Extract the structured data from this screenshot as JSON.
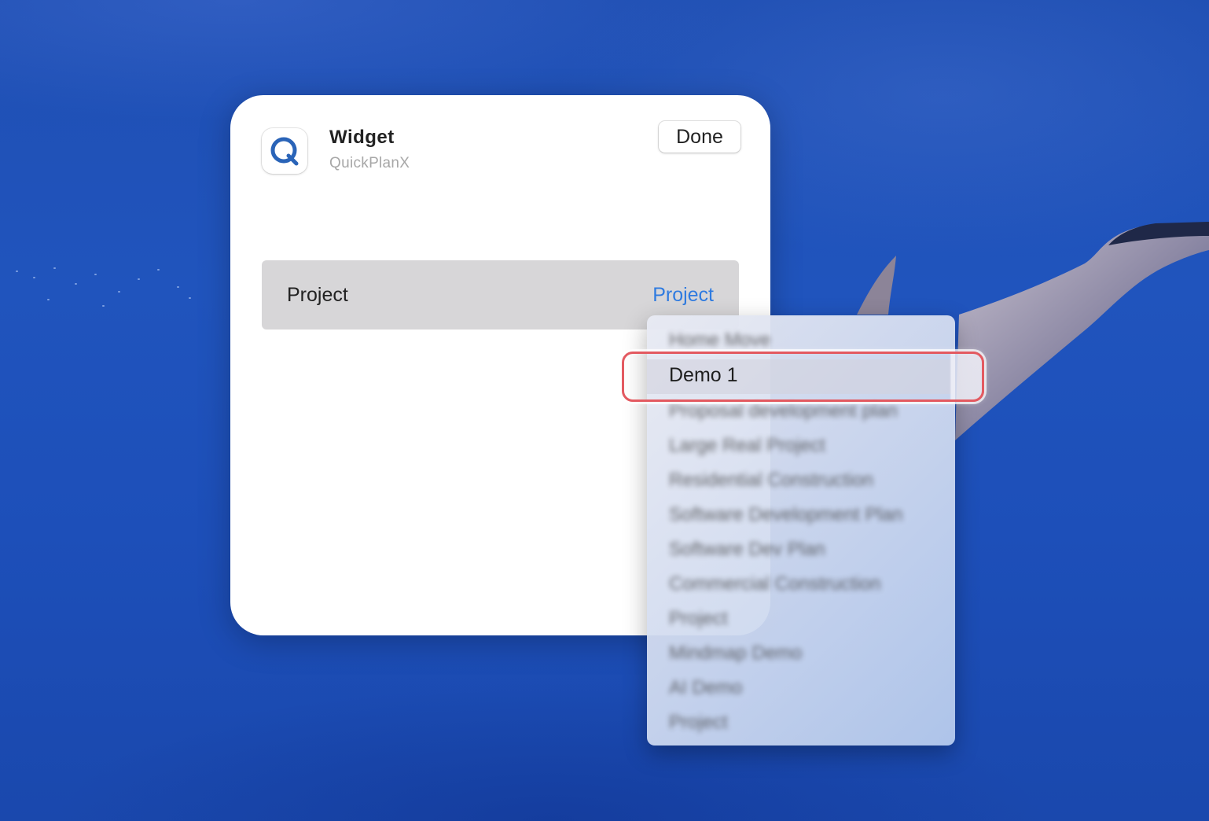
{
  "widget": {
    "title": "Widget",
    "app_name": "QuickPlanX",
    "done_label": "Done",
    "icon": "quickplanx-q-logo"
  },
  "project_row": {
    "label": "Project",
    "value": "Project"
  },
  "dropdown": {
    "items": [
      {
        "label": "Home Move"
      },
      {
        "label": "Demo 1",
        "selected": true
      },
      {
        "label": "Proposal development plan"
      },
      {
        "label": "Large Real Project"
      },
      {
        "label": "Residential Construction"
      },
      {
        "label": "Software Development Plan"
      },
      {
        "label": "Software Dev Plan"
      },
      {
        "label": "Commercial Construction"
      },
      {
        "label": "Project"
      },
      {
        "label": "Mindmap Demo"
      },
      {
        "label": "AI Demo"
      },
      {
        "label": "Project"
      }
    ]
  },
  "colors": {
    "accent": "#2f7be0",
    "highlight_ring": "#e35a61",
    "background": "#1f4fb3"
  }
}
